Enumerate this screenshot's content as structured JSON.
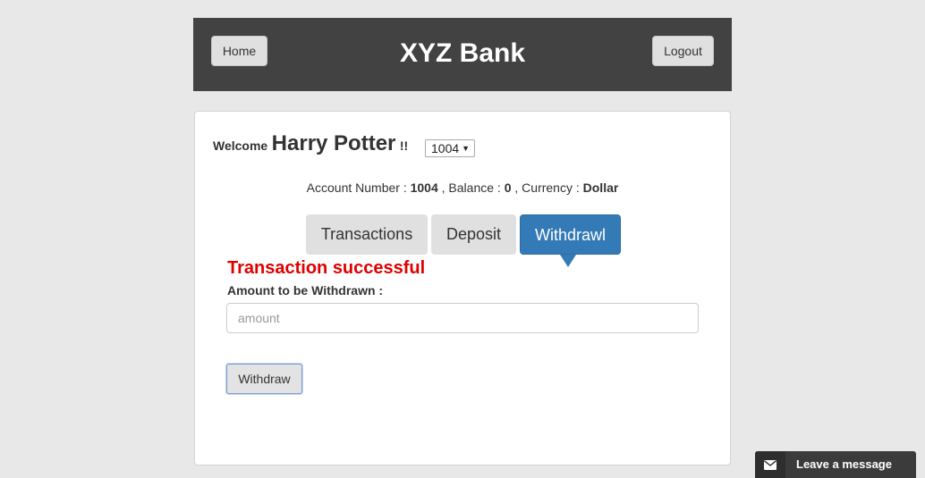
{
  "header": {
    "home_label": "Home",
    "title": "XYZ Bank",
    "logout_label": "Logout"
  },
  "welcome": {
    "label": "Welcome",
    "name": "Harry Potter",
    "suffix": "!!",
    "account_selected": "1004"
  },
  "account_info": {
    "account_label": "Account Number :",
    "account_number": "1004",
    "balance_label": ", Balance :",
    "balance": "0",
    "currency_label": ", Currency :",
    "currency": "Dollar"
  },
  "tabs": [
    {
      "label": "Transactions",
      "active": false
    },
    {
      "label": "Deposit",
      "active": false
    },
    {
      "label": "Withdrawl",
      "active": true
    }
  ],
  "form": {
    "message": "Transaction successful",
    "amount_label": "Amount to be Withdrawn :",
    "amount_placeholder": "amount",
    "submit_label": "Withdraw"
  },
  "chat": {
    "label": "Leave a message",
    "icon": "envelope-icon"
  },
  "colors": {
    "header_bg": "#424242",
    "active_tab": "#337ab7",
    "success_message": "#e00000",
    "page_bg": "#e8e8e8"
  }
}
